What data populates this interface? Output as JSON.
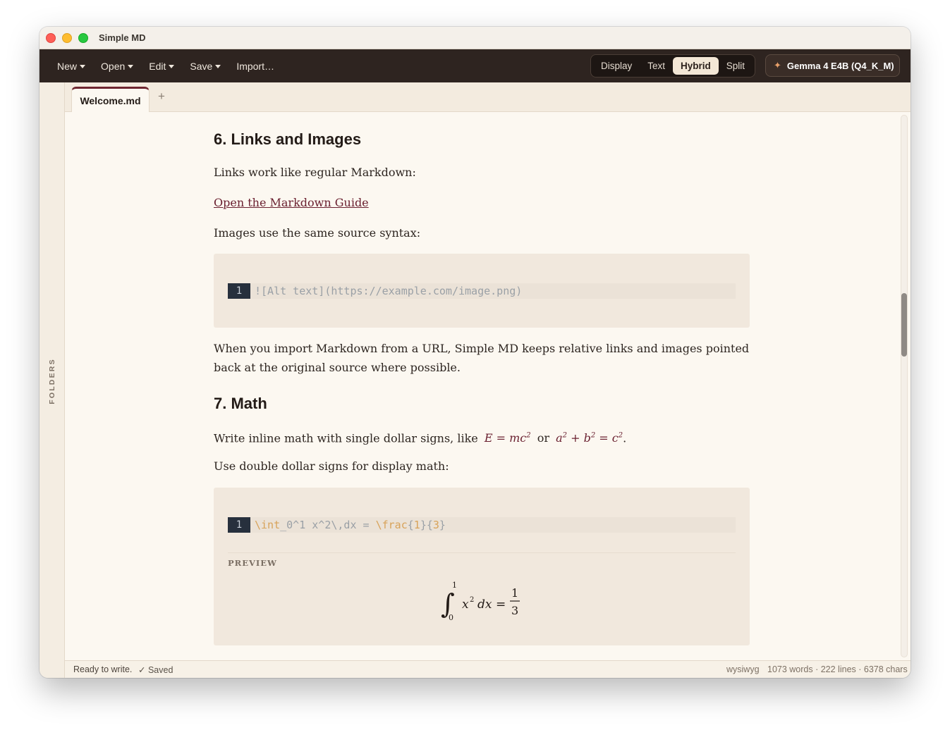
{
  "window": {
    "title": "Simple MD"
  },
  "toolbar": {
    "menu": [
      "New",
      "Open",
      "Edit",
      "Save",
      "Import…"
    ],
    "modes": [
      "Display",
      "Text",
      "Hybrid",
      "Split"
    ],
    "active_mode": "Hybrid",
    "model_label": "Gemma 4 E4B (Q4_K_M)",
    "model_icon": "sparkle-icon"
  },
  "sidebar": {
    "label": "FOLDERS"
  },
  "tabs": {
    "active": "Welcome.md",
    "add_label": "+"
  },
  "document": {
    "section6": {
      "heading": "6. Links and Images",
      "p1": "Links work like regular Markdown:",
      "link_text": "Open the Markdown Guide",
      "p2": "Images use the same source syntax:",
      "code_line_number": "1",
      "code": "![Alt text](https://example.com/image.png)",
      "p3": "When you import Markdown from a URL, Simple MD keeps relative links and images pointed back at the original source where possible."
    },
    "section7": {
      "heading": "7. Math",
      "p1_prefix": "Write inline math with single dollar signs, like",
      "inline_math_1": "E = mc²",
      "p1_or": "or",
      "inline_math_2": "a² + b² = c²",
      "p1_suffix": ".",
      "p2": "Use double dollar signs for display math:",
      "code_line_number": "1",
      "code_tokens": {
        "t1": "\\int",
        "t2": "_0^1 x^2\\,dx = ",
        "t3": "\\frac",
        "t4": "{",
        "t5": "1",
        "t6": "}{",
        "t7": "3",
        "t8": "}"
      },
      "preview_label": "PREVIEW"
    }
  },
  "status": {
    "left": "Ready to write.",
    "saved": "✓ Saved",
    "mode": "wysiwyg",
    "counts": "1073 words · 222 lines · 6378 chars"
  }
}
